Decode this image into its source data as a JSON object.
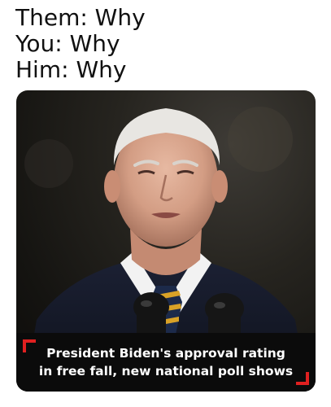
{
  "meme": {
    "lines": [
      "Them: Why",
      "You: Why",
      "Him: Why"
    ]
  },
  "news": {
    "headline_line1": "President Biden's approval rating",
    "headline_line2": "in free fall, new national poll shows"
  },
  "colors": {
    "banner_bg": "#0b0b0b",
    "accent": "#e02020"
  }
}
